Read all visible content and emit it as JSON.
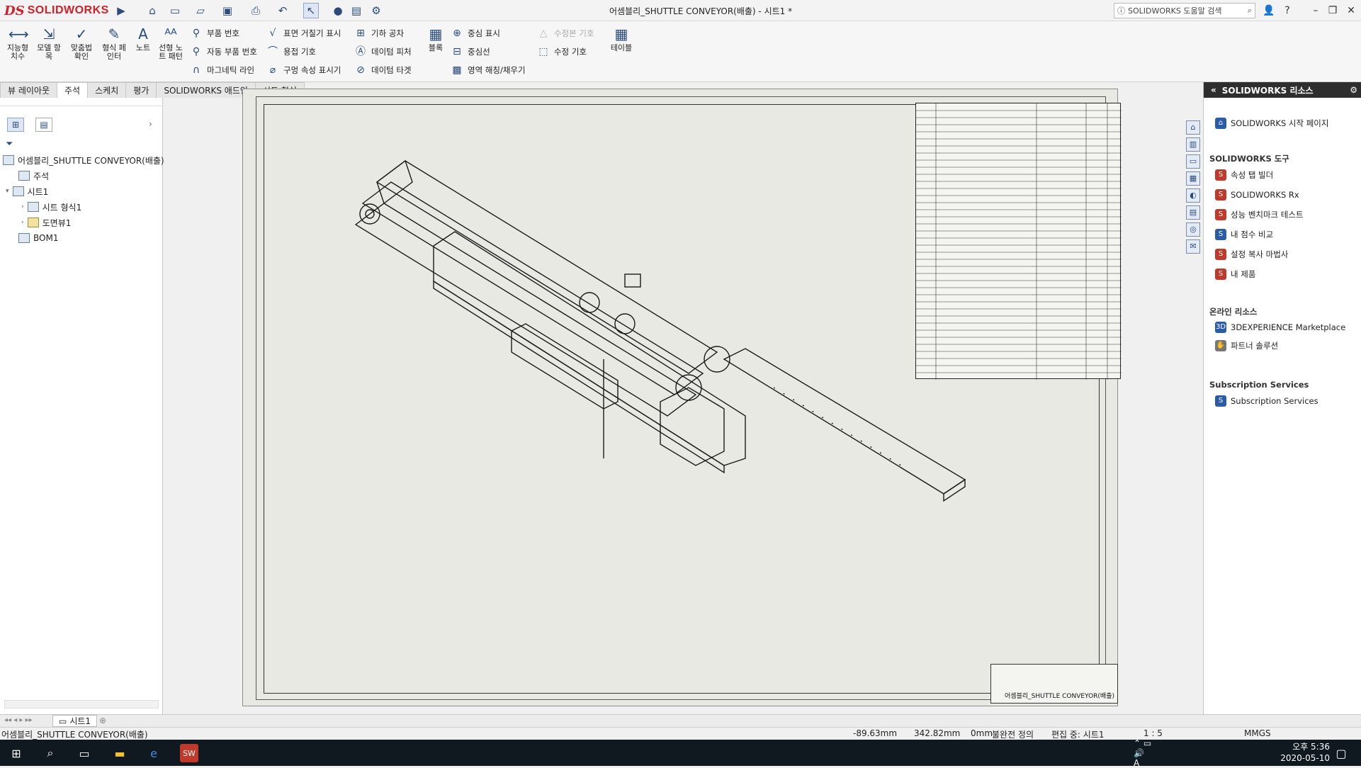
{
  "app": {
    "logo_ds": "DS",
    "logo_text": "SOLIDWORKS",
    "doc_title": "어셈블리_SHUTTLE CONVEYOR(배출) - 시트1 *",
    "search_placeholder": "SOLIDWORKS 도움말 검색",
    "colors": {
      "brand": "#d0202a",
      "ribbon_icon": "#2a4b7c",
      "taskbar": "#101820"
    }
  },
  "ribbon": {
    "big_buttons": [
      {
        "label": "지능형\n치수",
        "icon": "smart-dimension-icon"
      },
      {
        "label": "모델 항\n목",
        "icon": "model-items-icon"
      },
      {
        "label": "맞춤법\n확인",
        "icon": "spell-check-icon"
      },
      {
        "label": "형식 페\n인터",
        "icon": "format-painter-icon"
      },
      {
        "label": "노트",
        "icon": "note-icon"
      },
      {
        "label": "선형 노\n트 패턴",
        "icon": "linear-note-pattern-icon"
      },
      {
        "label": "블록",
        "icon": "block-icon"
      },
      {
        "label": "테이블",
        "icon": "table-icon"
      }
    ],
    "col1": [
      "부품 번호",
      "자동 부품 번호",
      "마그네틱 라인"
    ],
    "col2": [
      "표면 거칠기 표시",
      "용접 기호",
      "구멍 속성 표시기"
    ],
    "col3": [
      "기하 공차",
      "데이텀 피처",
      "데이텀 타겟"
    ],
    "col4": [
      "중심 표시",
      "중심선",
      "영역 해칭/채우기"
    ],
    "col5": [
      "수정본 기호",
      "수정 기호"
    ]
  },
  "tabs": [
    "뷰 레이아웃",
    "주석",
    "스케치",
    "평가",
    "SOLIDWORKS 애드인",
    "시트 형식"
  ],
  "active_tab": "주석",
  "tree": {
    "root": "어셈블리_SHUTTLE CONVEYOR(배출)",
    "annotations": "주석",
    "sheet": "시트1",
    "sheet_format": "시트 형식1",
    "drawing_view": "도면뷰1",
    "bom": "BOM1"
  },
  "taskpane": {
    "title": "SOLIDWORKS 리소스",
    "start_page": "SOLIDWORKS 시작 페이지",
    "tools_header": "SOLIDWORKS 도구",
    "tools": [
      "속성 탭 빌더",
      "SOLIDWORKS Rx",
      "성능 벤치마크 테스트",
      "내 점수 비교",
      "설정 복사 마법사",
      "내 제품"
    ],
    "online_header": "온라인 리소스",
    "online": [
      "3DEXPERIENCE Marketplace",
      "파트너 솔루션"
    ],
    "subs_header": "Subscription Services",
    "subs": [
      "Subscription Services"
    ]
  },
  "drawing": {
    "titleblock_name": "어셈블리_SHUTTLE CONVEYOR(배출)",
    "bom_rows": 38
  },
  "sheet_tab": "시트1",
  "status": {
    "doc": "어셈블리_SHUTTLE CONVEYOR(배출)",
    "x": "-89.63mm",
    "y": "342.82mm",
    "z": "0mm",
    "define": "불완전 정의",
    "editing": "편집 중: 시트1",
    "scale": "1 : 5",
    "units": "MMGS"
  },
  "taskbar": {
    "time": "오후 5:36",
    "date": "2020-05-10"
  }
}
